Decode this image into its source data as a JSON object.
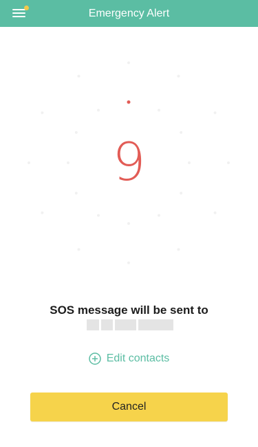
{
  "header": {
    "title": "Emergency Alert",
    "menu_icon": "hamburger-menu-icon",
    "notification_indicator": true,
    "background_color": "#5bbda3"
  },
  "countdown": {
    "value": "9",
    "color": "#e25c56"
  },
  "message": {
    "sos_text": "SOS message will be sent to"
  },
  "actions": {
    "edit_contacts_label": "Edit contacts",
    "edit_contacts_icon": "plus-circle-icon",
    "cancel_label": "Cancel",
    "cancel_color": "#f6d34b"
  }
}
